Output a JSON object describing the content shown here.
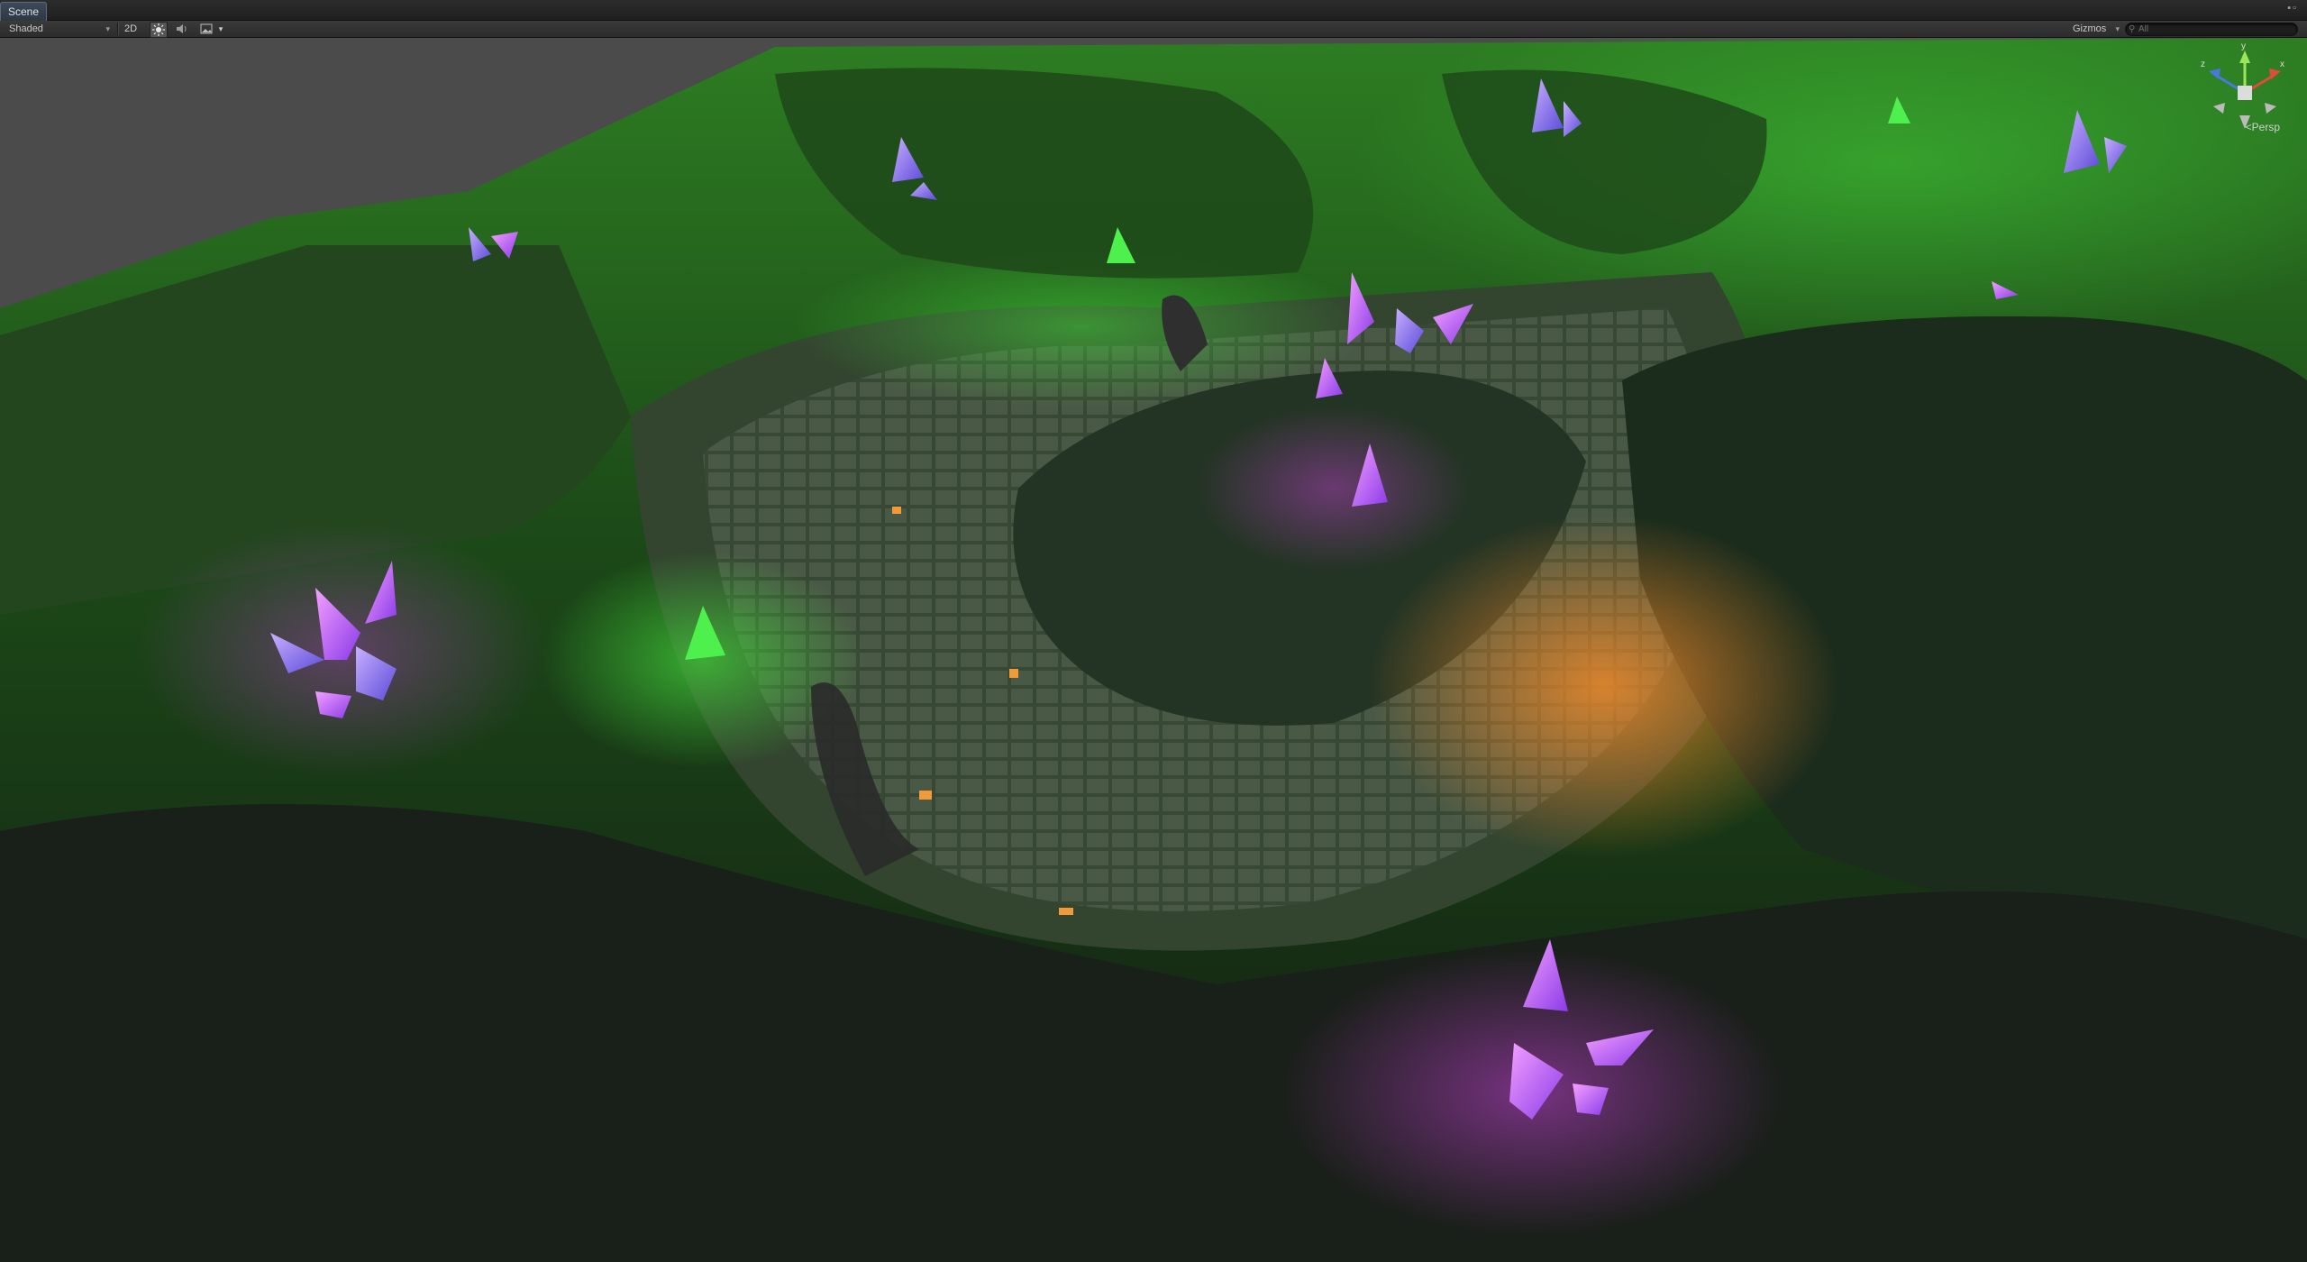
{
  "window": {
    "tab_label": "Scene",
    "window_controls": "▪▫"
  },
  "toolbar": {
    "shading_mode": "Shaded",
    "dropdown_arrow": "▾",
    "mode_2d": "2D",
    "lighting_icon": "sun-icon",
    "audio_icon": "speaker-icon",
    "effects_icon": "image-icon",
    "gizmos_label": "Gizmos",
    "search_placeholder": "All",
    "search_prefix": "⚲"
  },
  "scene_gizmo": {
    "projection_label": "Persp",
    "axis_y": "y",
    "axis_x": "x",
    "axis_z": "z"
  },
  "colors": {
    "crystal_pink": "#e040f0",
    "crystal_violet": "#9a6cf0",
    "crystal_green": "#3ef03e",
    "lava_orange": "#f08a2a",
    "terrain_green": "#1f5e1a"
  }
}
